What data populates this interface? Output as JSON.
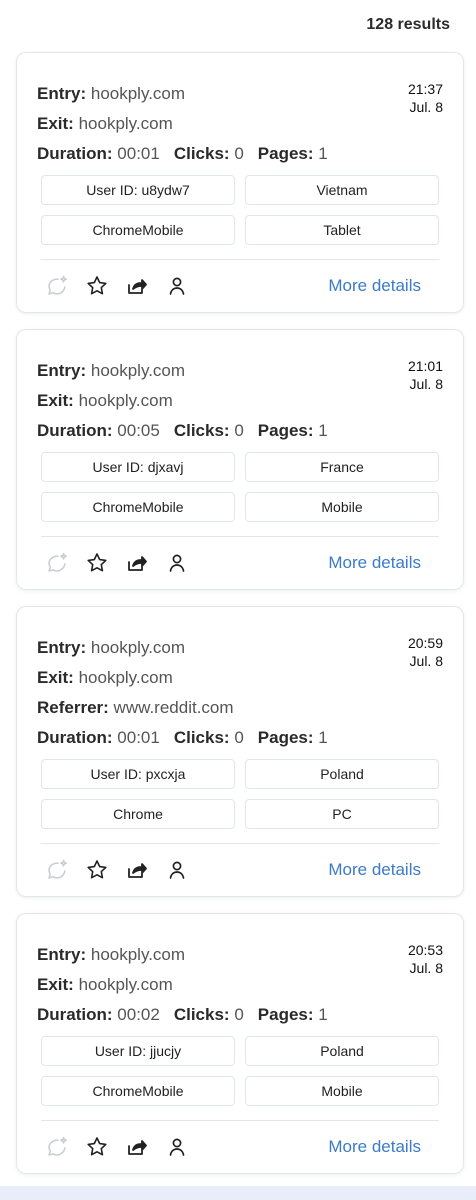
{
  "results_count": "128 results",
  "labels": {
    "entry": "Entry:",
    "exit": "Exit:",
    "referrer": "Referrer:",
    "duration": "Duration:",
    "clicks": "Clicks:",
    "pages": "Pages:",
    "more_details": "More details"
  },
  "icons": [
    "speech-bubble-sparkle-icon",
    "star-icon",
    "share-icon",
    "user-icon"
  ],
  "accent_color": "#3b7bc8",
  "sessions": [
    {
      "time": "21:37",
      "date": "Jul. 8",
      "entry": "hookply.com",
      "exit": "hookply.com",
      "duration": "00:01",
      "clicks": "0",
      "pages": "1",
      "user_id": "User ID: u8ydw7",
      "country": "Vietnam",
      "browser": "ChromeMobile",
      "device": "Tablet"
    },
    {
      "time": "21:01",
      "date": "Jul. 8",
      "entry": "hookply.com",
      "exit": "hookply.com",
      "duration": "00:05",
      "clicks": "0",
      "pages": "1",
      "user_id": "User ID: djxavj",
      "country": "France",
      "browser": "ChromeMobile",
      "device": "Mobile"
    },
    {
      "time": "20:59",
      "date": "Jul. 8",
      "entry": "hookply.com",
      "exit": "hookply.com",
      "referrer": "www.reddit.com",
      "duration": "00:01",
      "clicks": "0",
      "pages": "1",
      "user_id": "User ID: pxcxja",
      "country": "Poland",
      "browser": "Chrome",
      "device": "PC"
    },
    {
      "time": "20:53",
      "date": "Jul. 8",
      "entry": "hookply.com",
      "exit": "hookply.com",
      "duration": "00:02",
      "clicks": "0",
      "pages": "1",
      "user_id": "User ID: jjucjy",
      "country": "Poland",
      "browser": "ChromeMobile",
      "device": "Mobile"
    }
  ]
}
